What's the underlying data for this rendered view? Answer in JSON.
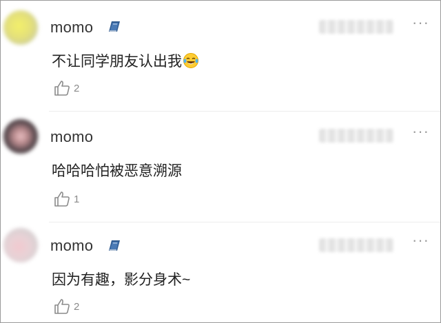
{
  "comments": [
    {
      "username": "momo",
      "badge": "book-badge-icon",
      "text": "不让同学朋友认出我",
      "emoji": "laughing-tears-emoji",
      "likes": "2"
    },
    {
      "username": "momo",
      "badge": "",
      "text": "哈哈哈怕被恶意溯源",
      "emoji": "",
      "likes": "1"
    },
    {
      "username": "momo",
      "badge": "book-badge-icon",
      "text": "因为有趣，影分身术~",
      "emoji": "",
      "likes": "2"
    }
  ],
  "more_glyph": "···",
  "colors": {
    "text": "#222222",
    "meta": "#8a8a8a",
    "badge": "#2f5a8f",
    "divider": "#ececec"
  }
}
